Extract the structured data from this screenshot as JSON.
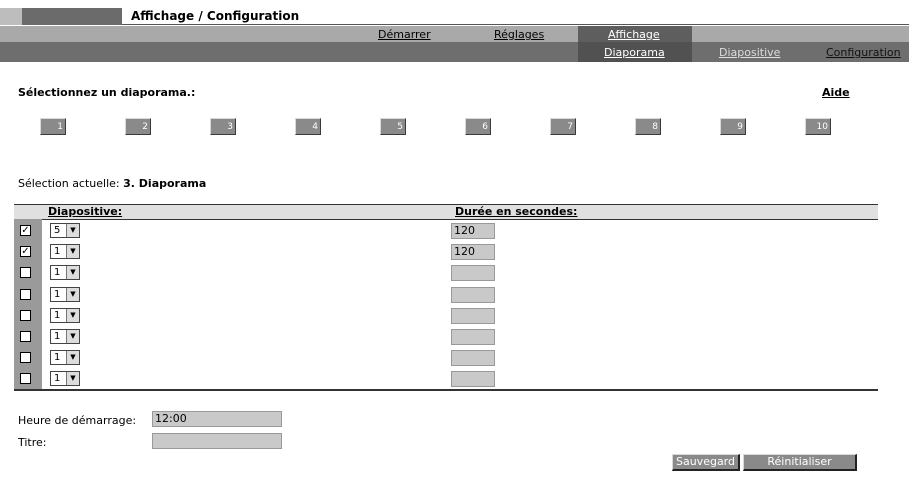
{
  "header": {
    "title": "Affichage / Configuration"
  },
  "nav": {
    "primary": [
      "Démarrer",
      "Réglages",
      "Affichage"
    ],
    "secondary": [
      "Diaporama",
      "Diapositive",
      "Configuration"
    ]
  },
  "select_label": "Sélectionnez un diaporama.:",
  "help_label": "Aide",
  "slideshow_buttons": [
    "1",
    "2",
    "3",
    "4",
    "5",
    "6",
    "7",
    "8",
    "9",
    "10"
  ],
  "current": {
    "label": "Sélection actuelle:",
    "value": "3. Diaporama"
  },
  "table": {
    "headers": [
      "Diapositive:",
      "Durée en secondes:"
    ],
    "rows": [
      {
        "checked": true,
        "slide": "5",
        "duration": "120"
      },
      {
        "checked": true,
        "slide": "1",
        "duration": "120"
      },
      {
        "checked": false,
        "slide": "1",
        "duration": ""
      },
      {
        "checked": false,
        "slide": "1",
        "duration": ""
      },
      {
        "checked": false,
        "slide": "1",
        "duration": ""
      },
      {
        "checked": false,
        "slide": "1",
        "duration": ""
      },
      {
        "checked": false,
        "slide": "1",
        "duration": ""
      },
      {
        "checked": false,
        "slide": "1",
        "duration": ""
      }
    ]
  },
  "form": {
    "start_label": "Heure de démarrage:",
    "start_value": "12:00",
    "title_label": "Titre:",
    "title_value": ""
  },
  "buttons": {
    "save": "Sauvegard",
    "reset": "Réinitialiser"
  }
}
